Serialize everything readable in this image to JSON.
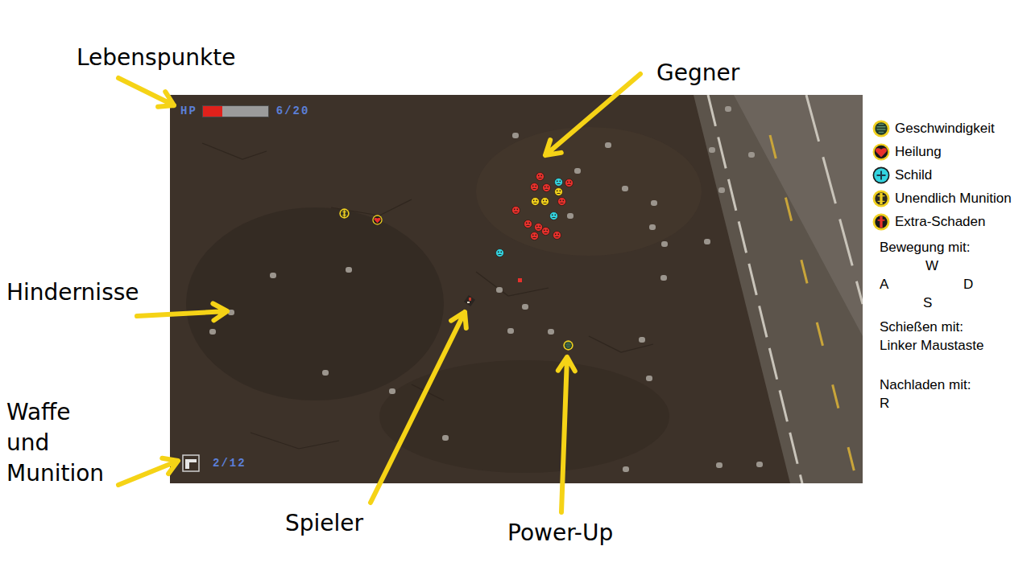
{
  "hud": {
    "hp": {
      "label": "HP",
      "level": 0.3,
      "text": "6/20"
    },
    "ammo": {
      "text": "2/12"
    }
  },
  "annotations": {
    "hp": "Lebenspunkte",
    "enemies": "Gegner",
    "obstacles": "Hindernisse",
    "weapon": [
      "Waffe",
      "und",
      "Munition"
    ],
    "player": "Spieler",
    "powerup": "Power-Up"
  },
  "enemies": [
    {
      "color": "#e8312c"
    },
    {
      "color": "#33d4e0"
    },
    {
      "color": "#e8312c"
    },
    {
      "color": "#e8312c"
    },
    {
      "color": "#e8312c"
    },
    {
      "color": "#f2d21b"
    },
    {
      "color": "#f2d21b"
    },
    {
      "color": "#f2d21b"
    },
    {
      "color": "#e8312c"
    },
    {
      "color": "#e8312c"
    },
    {
      "color": "#33d4e0"
    },
    {
      "color": "#e8312c"
    },
    {
      "color": "#e8312c"
    },
    {
      "color": "#e8312c"
    },
    {
      "color": "#e8312c"
    },
    {
      "color": "#e8312c"
    },
    {
      "color": "#33d4e0"
    }
  ],
  "map_powerups": [
    {
      "kind": "ammo"
    },
    {
      "kind": "heal"
    },
    {
      "kind": "speed"
    }
  ],
  "legend": [
    {
      "label": "Geschwindigkeit",
      "kind": "speed"
    },
    {
      "label": "Heilung",
      "kind": "heal"
    },
    {
      "label": "Schild",
      "kind": "shield"
    },
    {
      "label": "Unendlich Munition",
      "kind": "ammo"
    },
    {
      "label": "Extra-Schaden",
      "kind": "damage"
    }
  ],
  "controls": {
    "movement": {
      "label": "Bewegung mit:",
      "keys": {
        "up": "W",
        "left": "A",
        "right": "D",
        "down": "S"
      }
    },
    "shoot": {
      "label": "Schießen mit:",
      "value": "Linker Maustaste"
    },
    "reload": {
      "label": "Nachladen mit:",
      "value": "R"
    }
  }
}
